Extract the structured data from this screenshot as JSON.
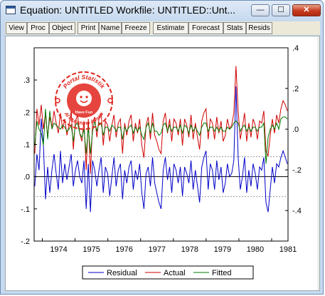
{
  "window": {
    "title": "Equation: UNTITLED   Workfile: UNTITLED::Unt...",
    "controls": {
      "minimize": "—",
      "maximize": "☐",
      "close": "✕"
    }
  },
  "toolbar": {
    "buttons": [
      "View",
      "Proc",
      "Object",
      "Print",
      "Name",
      "Freeze",
      "Estimate",
      "Forecast",
      "Stats",
      "Resids"
    ]
  },
  "stamp": {
    "top_text": "Portal Statistik",
    "bottom_text": "Al Muhshinn Almais",
    "center_text": "Have Fun",
    "color": "#e0241c"
  },
  "chart_data": {
    "type": "line",
    "title": "",
    "x_tick_labels": [
      "1974",
      "1975",
      "1976",
      "1977",
      "1978",
      "1979",
      "1980",
      "1981"
    ],
    "xlim": [
      1973.75,
      1981.5
    ],
    "left_axis": {
      "ticks": [
        "-.2",
        "-.1",
        ".0",
        ".1",
        ".2",
        ".3"
      ],
      "ylim": [
        -0.2,
        0.4
      ]
    },
    "right_axis": {
      "ticks": [
        "-.4",
        "-.2",
        ".0",
        ".2",
        ".4"
      ],
      "ylim": [
        -0.55,
        0.4
      ]
    },
    "reference_lines": {
      "zero": 0.0,
      "upper_band": 0.062,
      "lower_band": -0.062
    },
    "series": [
      {
        "name": "Residual",
        "color": "#0000c8",
        "axis": "left",
        "values": [
          -0.03,
          0.07,
          0.02,
          0.18,
          0.1,
          -0.07,
          0.03,
          -0.05,
          0.02,
          0.07,
          0.01,
          -0.04,
          0.08,
          -0.02,
          0.04,
          -0.01,
          0.03,
          0.07,
          -0.03,
          0.02,
          0.05,
          0.0,
          -0.02,
          0.05,
          -0.1,
          0.04,
          -0.11,
          0.05,
          0.02,
          -0.03,
          0.02,
          0.06,
          -0.05,
          0.03,
          0.01,
          -0.06,
          0.0,
          0.06,
          -0.03,
          0.02,
          0.04,
          -0.07,
          0.02,
          -0.02,
          0.03,
          0.05,
          -0.04,
          0.02,
          -0.01,
          0.04,
          -0.05,
          -0.1,
          0.01,
          0.03,
          -0.03,
          0.06,
          -0.02,
          -0.05,
          -0.08,
          -0.1,
          0.02,
          0.06,
          -0.01,
          0.03,
          -0.05,
          0.04,
          0.02,
          -0.02,
          0.03,
          -0.06,
          0.03,
          0.01,
          -0.02,
          0.05,
          -0.04,
          0.02,
          -0.03,
          -0.08,
          0.03,
          0.06,
          0.08,
          -0.04,
          0.04,
          0.02,
          -0.04,
          0.05,
          -0.01,
          0.03,
          -0.05,
          -0.02,
          0.04,
          0.0,
          0.01,
          0.05,
          0.28,
          0.06,
          -0.04,
          0.0,
          0.06,
          -0.05,
          0.02,
          -0.03,
          0.04,
          0.01,
          -0.04,
          0.03,
          0.02,
          0.06,
          -0.08,
          -0.11,
          -0.04,
          0.03,
          -0.02,
          0.04,
          0.03,
          0.06,
          0.08,
          0.06,
          0.04
        ]
      },
      {
        "name": "Actual",
        "color": "#d00000",
        "axis": "right",
        "values": [
          -0.12,
          0.1,
          0.02,
          0.12,
          0.0,
          0.08,
          -0.04,
          0.06,
          0.01,
          0.09,
          0.03,
          -0.02,
          0.08,
          0.0,
          0.05,
          -0.03,
          0.02,
          0.09,
          -0.1,
          0.04,
          0.07,
          -0.02,
          -0.06,
          0.04,
          -0.2,
          0.05,
          -0.22,
          0.03,
          0.06,
          -0.04,
          0.05,
          0.08,
          -0.08,
          0.04,
          0.02,
          -0.06,
          0.02,
          0.07,
          -0.04,
          0.03,
          0.05,
          -0.12,
          0.03,
          -0.03,
          0.04,
          0.07,
          -0.06,
          0.03,
          -0.02,
          0.05,
          -0.08,
          -0.14,
          0.02,
          0.06,
          -0.05,
          0.08,
          -0.03,
          -0.06,
          -0.1,
          -0.12,
          0.04,
          0.08,
          -0.02,
          0.05,
          -0.06,
          0.05,
          0.03,
          -0.03,
          0.05,
          -0.08,
          0.05,
          0.02,
          -0.04,
          0.07,
          -0.05,
          0.03,
          -0.04,
          -0.1,
          0.04,
          0.08,
          0.1,
          -0.05,
          0.05,
          0.03,
          -0.05,
          0.06,
          -0.02,
          0.04,
          -0.06,
          -0.03,
          0.05,
          0.0,
          0.02,
          0.08,
          0.31,
          0.09,
          -0.05,
          0.01,
          0.08,
          -0.06,
          0.03,
          -0.04,
          0.05,
          0.02,
          -0.05,
          0.04,
          0.03,
          0.09,
          -0.11,
          -0.13,
          -0.03,
          0.05,
          -0.02,
          0.07,
          0.03,
          0.1,
          0.14,
          0.12,
          0.09
        ]
      },
      {
        "name": "Fitted",
        "color": "#007a00",
        "axis": "right",
        "values": [
          -0.08,
          0.04,
          0.0,
          -0.02,
          -0.08,
          0.1,
          -0.05,
          0.09,
          0.0,
          0.03,
          0.02,
          0.01,
          0.0,
          0.02,
          0.01,
          -0.01,
          0.0,
          0.02,
          -0.06,
          0.02,
          0.03,
          -0.02,
          -0.04,
          0.0,
          -0.12,
          0.01,
          -0.12,
          -0.01,
          0.04,
          -0.01,
          0.03,
          0.03,
          -0.03,
          0.01,
          0.01,
          -0.01,
          0.02,
          0.01,
          -0.01,
          0.01,
          0.01,
          -0.05,
          0.01,
          -0.01,
          0.01,
          0.02,
          -0.02,
          0.01,
          -0.01,
          0.01,
          -0.03,
          -0.05,
          0.01,
          0.03,
          -0.02,
          0.03,
          -0.01,
          -0.01,
          -0.03,
          -0.02,
          0.02,
          0.03,
          -0.01,
          0.02,
          -0.01,
          0.01,
          0.01,
          -0.01,
          0.02,
          -0.02,
          0.02,
          0.01,
          -0.02,
          0.02,
          -0.01,
          0.01,
          -0.01,
          -0.03,
          0.01,
          0.03,
          0.03,
          -0.01,
          0.01,
          0.01,
          -0.01,
          0.01,
          -0.01,
          0.01,
          -0.01,
          -0.01,
          0.01,
          0.0,
          0.01,
          0.03,
          0.04,
          0.03,
          -0.01,
          0.01,
          0.02,
          -0.01,
          0.01,
          -0.01,
          0.01,
          0.01,
          -0.01,
          0.01,
          0.01,
          0.03,
          -0.17,
          -0.04,
          0.0,
          0.02,
          0.0,
          0.03,
          0.0,
          0.05,
          0.06,
          0.06,
          0.05
        ]
      }
    ],
    "legend": {
      "placement": "bottom-center",
      "entries": [
        "Residual",
        "Actual",
        "Fitted"
      ]
    }
  }
}
